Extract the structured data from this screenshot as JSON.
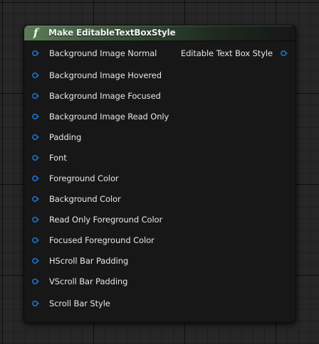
{
  "node": {
    "icon": "function-icon",
    "icon_glyph": "f",
    "title": "Make EditableTextBoxStyle",
    "header_color": "#4f7349",
    "pin_color": "#1a76d9",
    "inputs": [
      {
        "label": "Background Image Normal"
      },
      {
        "label": "Background Image Hovered"
      },
      {
        "label": "Background Image Focused"
      },
      {
        "label": "Background Image Read Only"
      },
      {
        "label": "Padding"
      },
      {
        "label": "Font"
      },
      {
        "label": "Foreground Color"
      },
      {
        "label": "Background Color"
      },
      {
        "label": "Read Only Foreground Color"
      },
      {
        "label": "Focused Foreground Color"
      },
      {
        "label": "HScroll Bar Padding"
      },
      {
        "label": "VScroll Bar Padding"
      },
      {
        "label": "Scroll Bar Style"
      }
    ],
    "output": {
      "label": "Editable Text Box Style"
    }
  }
}
